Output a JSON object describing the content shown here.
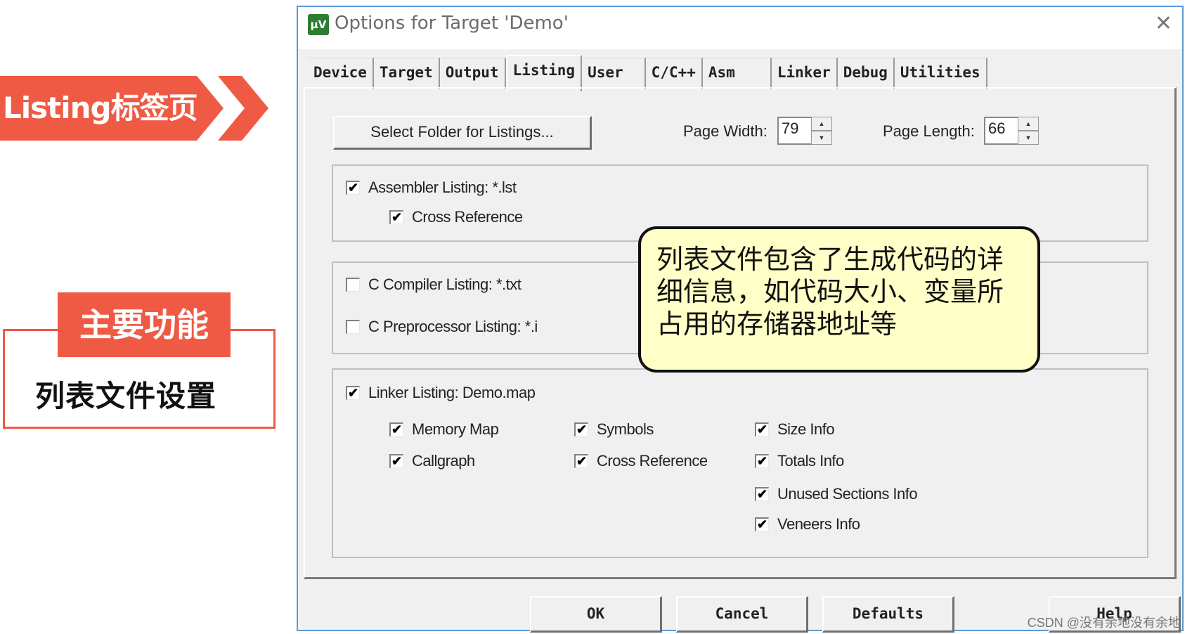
{
  "annotations": {
    "tab_banner": "Listing标签页",
    "main_function_tag": "主要功能",
    "main_function_text": "列表文件设置",
    "callout": "列表文件包含了生成代码的详细信息，如代码大小、变量所占用的存储器地址等",
    "accent_color": "#ef5a45"
  },
  "window": {
    "title": "Options for Target 'Demo'",
    "icon": "keil-uvision-icon",
    "close_label": "✕"
  },
  "tabs": [
    {
      "label": "Device",
      "active": false
    },
    {
      "label": "Target",
      "active": false
    },
    {
      "label": "Output",
      "active": false
    },
    {
      "label": "Listing",
      "active": true
    },
    {
      "label": "User",
      "active": false
    },
    {
      "label": "C/C++",
      "active": false
    },
    {
      "label": "Asm",
      "active": false
    },
    {
      "label": "Linker",
      "active": false
    },
    {
      "label": "Debug",
      "active": false
    },
    {
      "label": "Utilities",
      "active": false
    }
  ],
  "listing": {
    "select_folder_label": "Select Folder for Listings...",
    "page_width_label": "Page Width:",
    "page_width_value": "79",
    "page_length_label": "Page Length:",
    "page_length_value": "66",
    "assembler": {
      "label": "Assembler Listing:  *.lst",
      "checked": true,
      "cross_reference": {
        "label": "Cross Reference",
        "checked": true
      }
    },
    "c_compiler": {
      "label": "C Compiler Listing:  *.txt",
      "checked": false
    },
    "c_preprocessor": {
      "label": "C Preprocessor Listing:  *.i",
      "checked": false
    },
    "linker": {
      "label": "Linker Listing:  Demo.map",
      "checked": true,
      "options": [
        {
          "label": "Memory Map",
          "checked": true
        },
        {
          "label": "Callgraph",
          "checked": true
        },
        {
          "label": "Symbols",
          "checked": true
        },
        {
          "label": "Cross Reference",
          "checked": true
        },
        {
          "label": "Size Info",
          "checked": true
        },
        {
          "label": "Totals Info",
          "checked": true
        },
        {
          "label": "Unused Sections Info",
          "checked": true
        },
        {
          "label": "Veneers Info",
          "checked": true
        }
      ]
    }
  },
  "buttons": {
    "ok": "OK",
    "cancel": "Cancel",
    "defaults": "Defaults",
    "help": "Help"
  },
  "check_glyph": "✔",
  "spin_up_glyph": "▲",
  "spin_down_glyph": "▼",
  "watermark": "CSDN @没有余地没有余地"
}
